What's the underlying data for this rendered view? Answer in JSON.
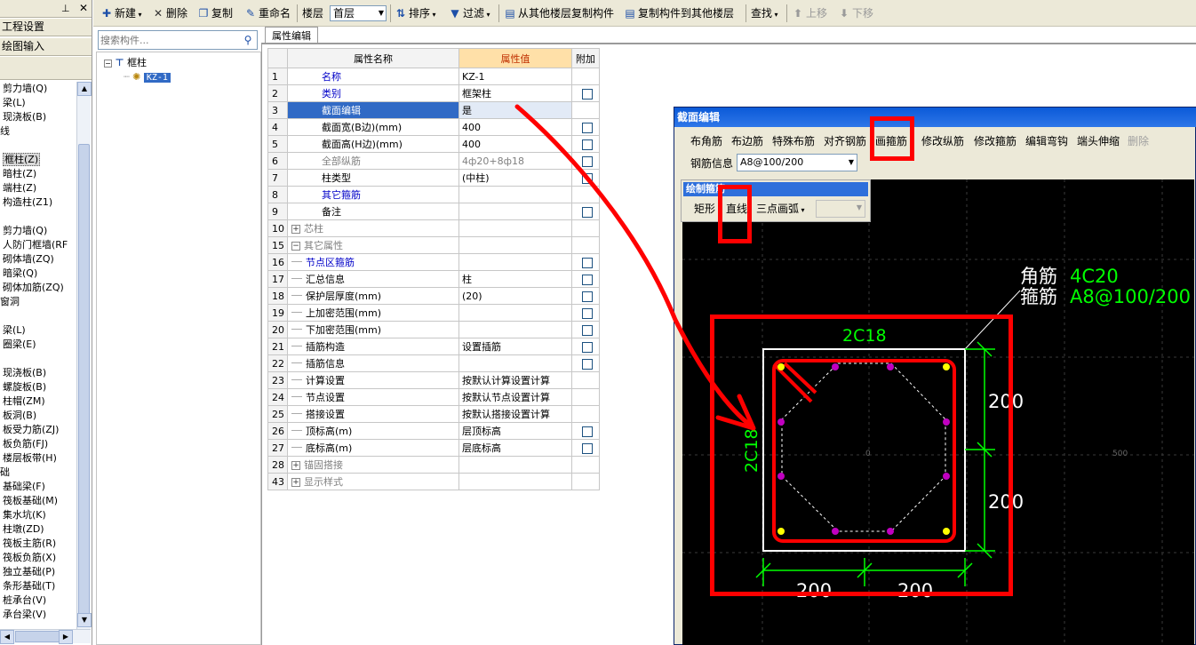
{
  "left_panel": {
    "header_pin": "⊥",
    "header_close": "✕",
    "strips": [
      "工程设置",
      "绘图输入"
    ],
    "items": [
      {
        "label": "剪力墙(Q)",
        "indent": 1
      },
      {
        "label": "梁(L)",
        "indent": 1
      },
      {
        "label": "现浇板(B)",
        "indent": 1
      },
      {
        "label": "线",
        "indent": 0
      },
      {
        "label": "",
        "indent": 0
      },
      {
        "label": "框柱(Z)",
        "indent": 1,
        "selected": true
      },
      {
        "label": "暗柱(Z)",
        "indent": 1
      },
      {
        "label": "端柱(Z)",
        "indent": 1
      },
      {
        "label": "构造柱(Z1)",
        "indent": 1
      },
      {
        "label": "",
        "indent": 0
      },
      {
        "label": "剪力墙(Q)",
        "indent": 1
      },
      {
        "label": "人防门框墙(RF",
        "indent": 1
      },
      {
        "label": "砌体墙(ZQ)",
        "indent": 1
      },
      {
        "label": "暗梁(Q)",
        "indent": 1
      },
      {
        "label": "砌体加筋(ZQ)",
        "indent": 1
      },
      {
        "label": "窗洞",
        "indent": 0
      },
      {
        "label": "",
        "indent": 0
      },
      {
        "label": "梁(L)",
        "indent": 1
      },
      {
        "label": "圈梁(E)",
        "indent": 1
      },
      {
        "label": "",
        "indent": 0
      },
      {
        "label": "现浇板(B)",
        "indent": 1
      },
      {
        "label": "螺旋板(B)",
        "indent": 1
      },
      {
        "label": "柱帽(ZM)",
        "indent": 1
      },
      {
        "label": "板洞(B)",
        "indent": 1
      },
      {
        "label": "板受力筋(ZJ)",
        "indent": 1
      },
      {
        "label": "板负筋(FJ)",
        "indent": 1
      },
      {
        "label": "楼层板带(H)",
        "indent": 1
      },
      {
        "label": "础",
        "indent": 0
      },
      {
        "label": "基础梁(F)",
        "indent": 1
      },
      {
        "label": "筏板基础(M)",
        "indent": 1
      },
      {
        "label": "集水坑(K)",
        "indent": 1
      },
      {
        "label": "柱墩(ZD)",
        "indent": 1
      },
      {
        "label": "筏板主筋(R)",
        "indent": 1
      },
      {
        "label": "筏板负筋(X)",
        "indent": 1
      },
      {
        "label": "独立基础(P)",
        "indent": 1
      },
      {
        "label": "条形基础(T)",
        "indent": 1
      },
      {
        "label": "桩承台(V)",
        "indent": 1
      },
      {
        "label": "承台梁(V)",
        "indent": 1
      }
    ]
  },
  "toolbar": {
    "new_label": "新建",
    "delete_label": "删除",
    "copy_label": "复制",
    "rename_label": "重命名",
    "floor_label": "楼层",
    "floor_value": "首层",
    "sort_label": "排序",
    "filter_label": "过滤",
    "copy_from_floor_label": "从其他楼层复制构件",
    "copy_to_floor_label": "复制构件到其他楼层",
    "find_label": "查找",
    "move_up_label": "上移",
    "move_down_label": "下移"
  },
  "tree": {
    "search_placeholder": "搜索构件...",
    "root_label": "框柱",
    "child_label": "KZ-1"
  },
  "props": {
    "tab_label": "属性编辑",
    "headers": {
      "name": "属性名称",
      "value": "属性值",
      "extra": "附加"
    },
    "rows": [
      {
        "num": "1",
        "name": "名称",
        "value": "KZ-1",
        "style": "blue",
        "level": 0,
        "check": false
      },
      {
        "num": "2",
        "name": "类别",
        "value": "框架柱",
        "style": "blue",
        "level": 0,
        "check": true
      },
      {
        "num": "3",
        "name": "截面编辑",
        "value": "是",
        "style": "normal",
        "level": 0,
        "check": false,
        "selected": true
      },
      {
        "num": "4",
        "name": "截面宽(B边)(mm)",
        "value": "400",
        "style": "normal",
        "level": 0,
        "check": true
      },
      {
        "num": "5",
        "name": "截面高(H边)(mm)",
        "value": "400",
        "style": "normal",
        "level": 0,
        "check": true
      },
      {
        "num": "6",
        "name": "全部纵筋",
        "value": "4ф20+8ф18",
        "style": "gray",
        "level": 0,
        "check": true
      },
      {
        "num": "7",
        "name": "柱类型",
        "value": "(中柱)",
        "style": "normal",
        "level": 0,
        "check": true
      },
      {
        "num": "8",
        "name": "其它箍筋",
        "value": "",
        "style": "blue",
        "level": 0,
        "check": false
      },
      {
        "num": "9",
        "name": "备注",
        "value": "",
        "style": "normal",
        "level": 0,
        "check": true
      },
      {
        "num": "10",
        "name": "芯柱",
        "value": "",
        "style": "gray",
        "level": 0,
        "check": false,
        "expander": "+"
      },
      {
        "num": "15",
        "name": "其它属性",
        "value": "",
        "style": "gray",
        "level": 0,
        "check": false,
        "expander": "−"
      },
      {
        "num": "16",
        "name": "节点区箍筋",
        "value": "",
        "style": "blue",
        "level": 1,
        "check": true
      },
      {
        "num": "17",
        "name": "汇总信息",
        "value": "柱",
        "style": "normal",
        "level": 1,
        "check": true
      },
      {
        "num": "18",
        "name": "保护层厚度(mm)",
        "value": "(20)",
        "style": "normal",
        "level": 1,
        "check": true
      },
      {
        "num": "19",
        "name": "上加密范围(mm)",
        "value": "",
        "style": "normal",
        "level": 1,
        "check": true
      },
      {
        "num": "20",
        "name": "下加密范围(mm)",
        "value": "",
        "style": "normal",
        "level": 1,
        "check": true
      },
      {
        "num": "21",
        "name": "插筋构造",
        "value": "设置插筋",
        "style": "normal",
        "level": 1,
        "check": true
      },
      {
        "num": "22",
        "name": "插筋信息",
        "value": "",
        "style": "normal",
        "level": 1,
        "check": true
      },
      {
        "num": "23",
        "name": "计算设置",
        "value": "按默认计算设置计算",
        "style": "normal",
        "level": 1,
        "check": false
      },
      {
        "num": "24",
        "name": "节点设置",
        "value": "按默认节点设置计算",
        "style": "normal",
        "level": 1,
        "check": false
      },
      {
        "num": "25",
        "name": "搭接设置",
        "value": "按默认搭接设置计算",
        "style": "normal",
        "level": 1,
        "check": false
      },
      {
        "num": "26",
        "name": "顶标高(m)",
        "value": "层顶标高",
        "style": "normal",
        "level": 1,
        "check": true
      },
      {
        "num": "27",
        "name": "底标高(m)",
        "value": "层底标高",
        "style": "normal",
        "level": 1,
        "check": true
      },
      {
        "num": "28",
        "name": "锚固搭接",
        "value": "",
        "style": "gray",
        "level": 0,
        "check": false,
        "expander": "+"
      },
      {
        "num": "43",
        "name": "显示样式",
        "value": "",
        "style": "gray",
        "level": 0,
        "check": false,
        "expander": "+"
      }
    ]
  },
  "section_editor": {
    "title": "截面编辑",
    "toolbar": [
      "布角筋",
      "布边筋",
      "特殊布筋",
      "对齐钢筋",
      "画箍筋",
      "修改纵筋",
      "修改箍筋",
      "编辑弯钩",
      "端头伸缩",
      "删除"
    ],
    "rebar_label": "钢筋信息",
    "rebar_value": "A8@100/200",
    "draw_panel": {
      "title": "绘制箍筋",
      "buttons": [
        "矩形",
        "直线",
        "三点画弧"
      ]
    },
    "canvas": {
      "corner_label": "角筋",
      "corner_value": "4C20",
      "stirrup_label": "箍筋",
      "stirrup_value": "A8@100/200",
      "top_bars": "2C18",
      "side_bars": "2C18",
      "dim_right_top": "200",
      "dim_right_bottom": "200",
      "dim_bottom_left": "200",
      "dim_bottom_right": "200",
      "axis_origin": "0",
      "axis_right": "500",
      "axis_top": "0"
    }
  },
  "colors": {
    "annotation_red": "#ff0000",
    "dimension_green": "#00ff00",
    "canvas_bg": "#000000",
    "selection_blue": "#316ac5"
  }
}
